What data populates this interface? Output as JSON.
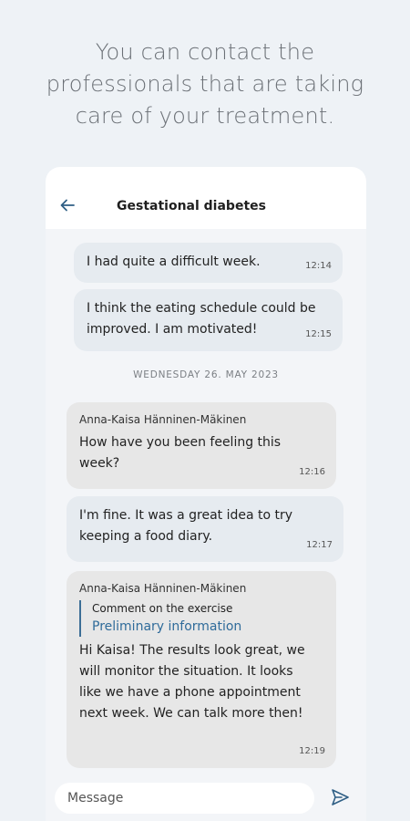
{
  "headline": {
    "line1": "You can contact the",
    "line2": "professionals that are taking",
    "line3": "care of your treatment."
  },
  "chat": {
    "title": "Gestational diabetes",
    "messages": [
      {
        "type": "sent",
        "text": "I had quite a difficult week.",
        "time": "12:14"
      },
      {
        "type": "sent",
        "text": "I think the eating schedule could be improved. I am motivated!",
        "time": "12:15"
      }
    ],
    "date_separator": "WEDNESDAY 26. MAY 2023",
    "messages2": [
      {
        "type": "received",
        "sender": "Anna-Kaisa Hänninen-Mäkinen",
        "text": "How have you been feeling this week?",
        "time": "12:16"
      },
      {
        "type": "sent",
        "text": "I'm fine. It was a great idea to try keeping a food diary.",
        "time": "12:17"
      },
      {
        "type": "received",
        "sender": "Anna-Kaisa Hänninen-Mäkinen",
        "quote_title": "Comment on the exercise",
        "quote_link": "Preliminary information",
        "text": "Hi Kaisa! The results look great, we will monitor the situation. It looks like we have a phone appointment next week. We can talk more then!",
        "time": "12:19"
      }
    ]
  },
  "composer": {
    "placeholder": "Message",
    "send_icon": "send-icon"
  },
  "icons": {
    "back": "back-arrow-icon"
  },
  "colors": {
    "accent": "#2f5f85",
    "background": "#eef2f6",
    "sent_bubble": "#e6ebf0",
    "received_bubble": "#e7e7e7"
  }
}
